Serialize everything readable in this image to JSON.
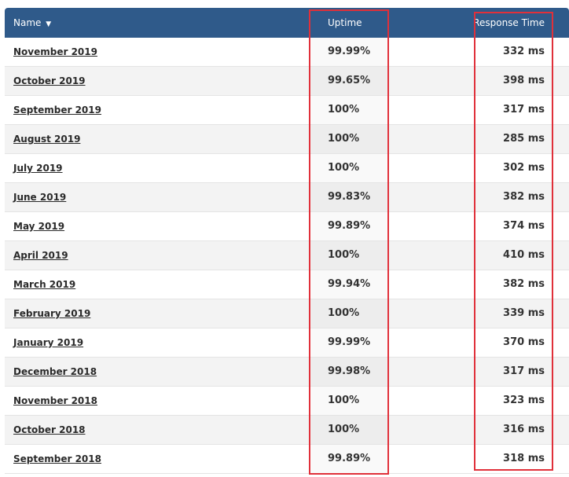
{
  "table": {
    "columns": {
      "name": "Name",
      "name_sort_indicator": "▼",
      "uptime": "Uptime",
      "response_time": "Response Time"
    },
    "rows": [
      {
        "name": "November 2019",
        "uptime": "99.99%",
        "response_time": "332 ms"
      },
      {
        "name": "October 2019",
        "uptime": "99.65%",
        "response_time": "398 ms"
      },
      {
        "name": "September 2019",
        "uptime": "100%",
        "response_time": "317 ms"
      },
      {
        "name": "August 2019",
        "uptime": "100%",
        "response_time": "285 ms"
      },
      {
        "name": "July 2019",
        "uptime": "100%",
        "response_time": "302 ms"
      },
      {
        "name": "June 2019",
        "uptime": "99.83%",
        "response_time": "382 ms"
      },
      {
        "name": "May 2019",
        "uptime": "99.89%",
        "response_time": "374 ms"
      },
      {
        "name": "April 2019",
        "uptime": "100%",
        "response_time": "410 ms"
      },
      {
        "name": "March 2019",
        "uptime": "99.94%",
        "response_time": "382 ms"
      },
      {
        "name": "February 2019",
        "uptime": "100%",
        "response_time": "339 ms"
      },
      {
        "name": "January 2019",
        "uptime": "99.99%",
        "response_time": "370 ms"
      },
      {
        "name": "December 2018",
        "uptime": "99.98%",
        "response_time": "317 ms"
      },
      {
        "name": "November 2018",
        "uptime": "100%",
        "response_time": "323 ms"
      },
      {
        "name": "October 2018",
        "uptime": "100%",
        "response_time": "316 ms"
      },
      {
        "name": "September 2018",
        "uptime": "99.89%",
        "response_time": "318 ms"
      }
    ]
  },
  "colors": {
    "header_bg": "#2f5a8a",
    "highlight_border": "#e0303a"
  }
}
